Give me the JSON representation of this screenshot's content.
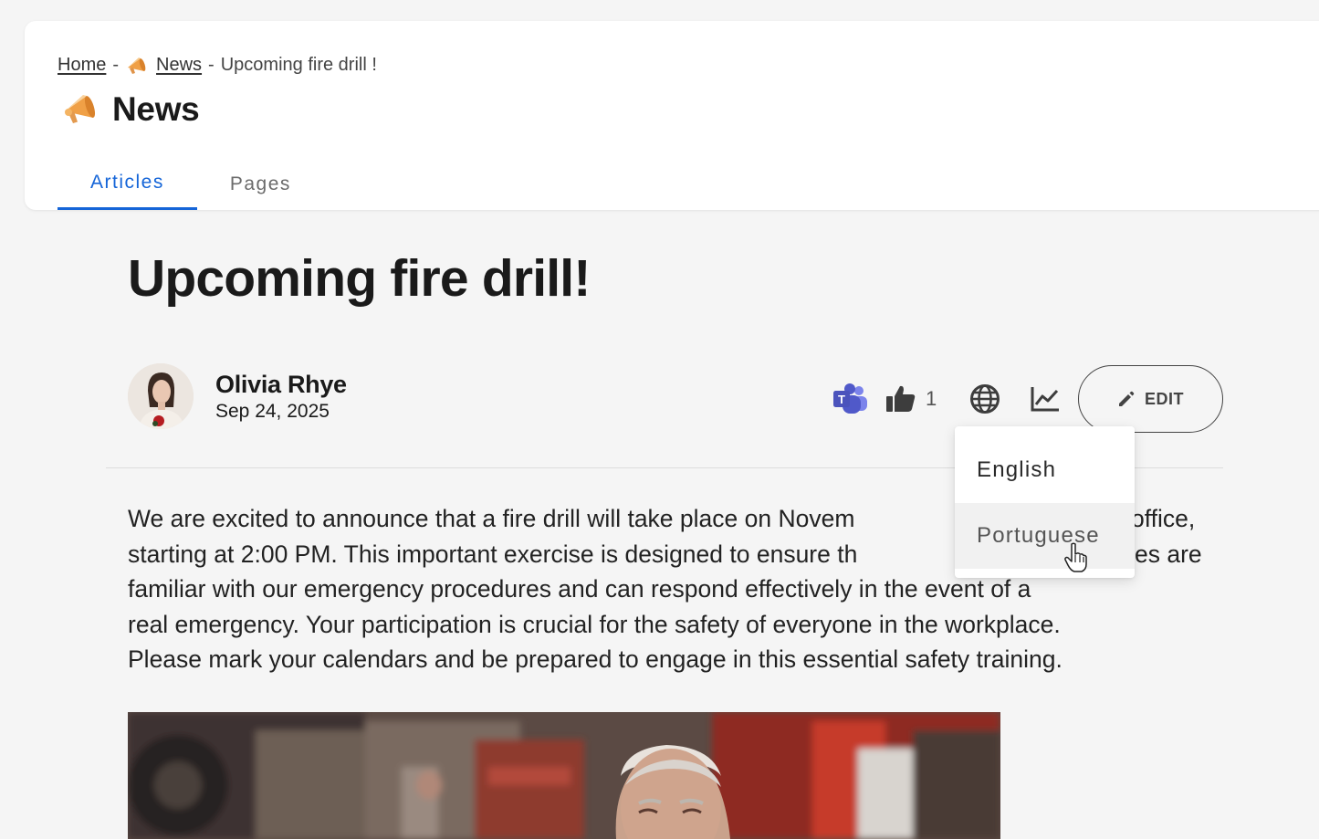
{
  "breadcrumb": {
    "home": "Home",
    "sep": "-",
    "news": "News",
    "current": "Upcoming fire drill !"
  },
  "header": {
    "title": "News"
  },
  "tabs": [
    {
      "label": "Articles",
      "active": true
    },
    {
      "label": "Pages",
      "active": false
    }
  ],
  "article": {
    "title": "Upcoming fire drill!",
    "author": "Olivia Rhye",
    "date": "Sep 24, 2025",
    "likes": "1",
    "body": "We are excited to announce that a fire drill will take place on November ... office, starting at 2:00 PM. This important exercise is designed to ensure that ... es are familiar with our emergency procedures and can respond effectively in the event of a real emergency. Your participation is crucial for the safety of everyone in the workplace. Please mark your calendars and be prepared to engage in this essential safety training."
  },
  "body_lines": [
    "We are excited to announce that a fire drill will take place on Novem",
    "office,",
    "starting at 2:00 PM. This important exercise is designed to ensure th",
    "es are",
    "familiar with our emergency procedures and can respond effectively in the event of a",
    "real emergency. Your participation is crucial for the safety of everyone in the workplace.",
    "Please mark your calendars and be prepared to engage in this essential safety training."
  ],
  "actions": {
    "edit_label": "EDIT"
  },
  "language_menu": {
    "items": [
      "English",
      "Portuguese"
    ],
    "hovered": "Portuguese"
  },
  "colors": {
    "accent": "#1565d8",
    "megaphone": "#f0a046",
    "teams": "#5059c9"
  },
  "icons": {
    "breadcrumb_news": "megaphone-icon",
    "header": "megaphone-icon",
    "teams": "teams-icon",
    "like": "thumbs-up-icon",
    "language": "globe-icon",
    "analytics": "chart-line-icon",
    "edit": "pencil-icon"
  }
}
